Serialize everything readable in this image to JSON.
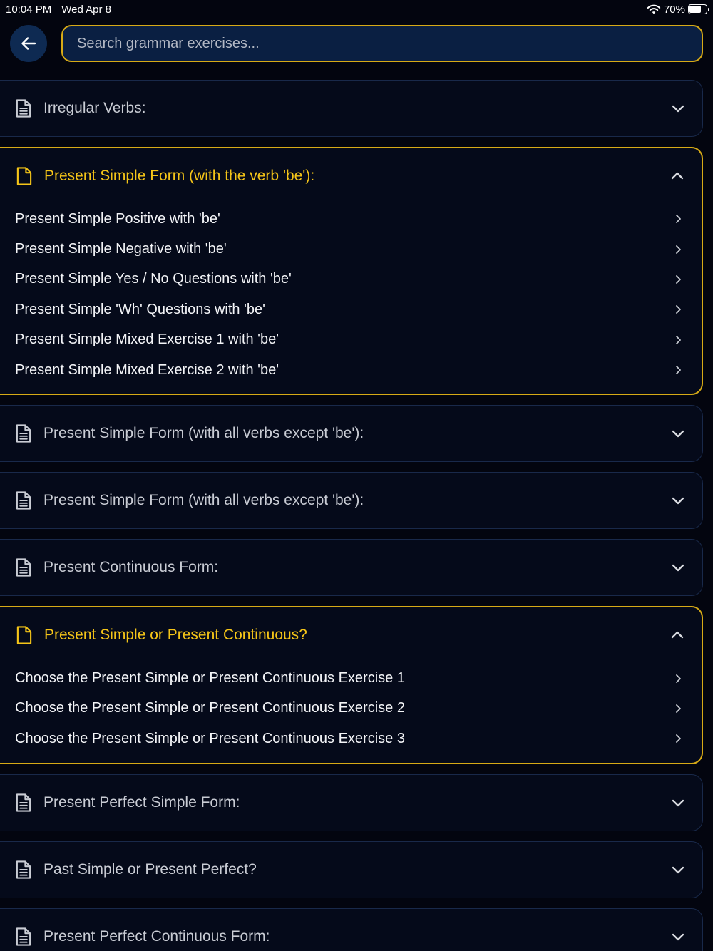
{
  "status": {
    "time": "10:04 PM",
    "date": "Wed Apr 8",
    "battery_text": "70%",
    "battery_level": 0.7
  },
  "header": {
    "back_icon": "arrow-left-icon",
    "search_placeholder": "Search grammar exercises..."
  },
  "colors": {
    "accent": "#d7aa16",
    "background": "#03050f",
    "card_border": "#19294a"
  },
  "sections": [
    {
      "title": "Irregular Verbs:",
      "expanded": false,
      "items": []
    },
    {
      "title": "Present Simple Form (with the verb 'be'):",
      "expanded": true,
      "items": [
        "Present Simple Positive with 'be'",
        "Present Simple Negative with 'be'",
        "Present Simple Yes / No Questions with 'be'",
        "Present Simple 'Wh' Questions with 'be'",
        "Present Simple Mixed Exercise 1 with 'be'",
        "Present Simple Mixed Exercise 2 with 'be'"
      ]
    },
    {
      "title": "Present Simple Form (with all verbs except 'be'):",
      "expanded": false,
      "items": []
    },
    {
      "title": "Present Simple Form (with all verbs except 'be'):",
      "expanded": false,
      "items": []
    },
    {
      "title": "Present Continuous Form:",
      "expanded": false,
      "items": []
    },
    {
      "title": "Present Simple or Present Continuous?",
      "expanded": true,
      "items": [
        "Choose the Present Simple or Present Continuous Exercise 1",
        "Choose the Present Simple or Present Continuous Exercise 2",
        "Choose the Present Simple or Present Continuous Exercise 3"
      ]
    },
    {
      "title": "Present Perfect Simple Form:",
      "expanded": false,
      "items": []
    },
    {
      "title": "Past Simple or Present Perfect?",
      "expanded": false,
      "items": []
    },
    {
      "title": "Present Perfect Continuous Form:",
      "expanded": false,
      "items": []
    }
  ]
}
